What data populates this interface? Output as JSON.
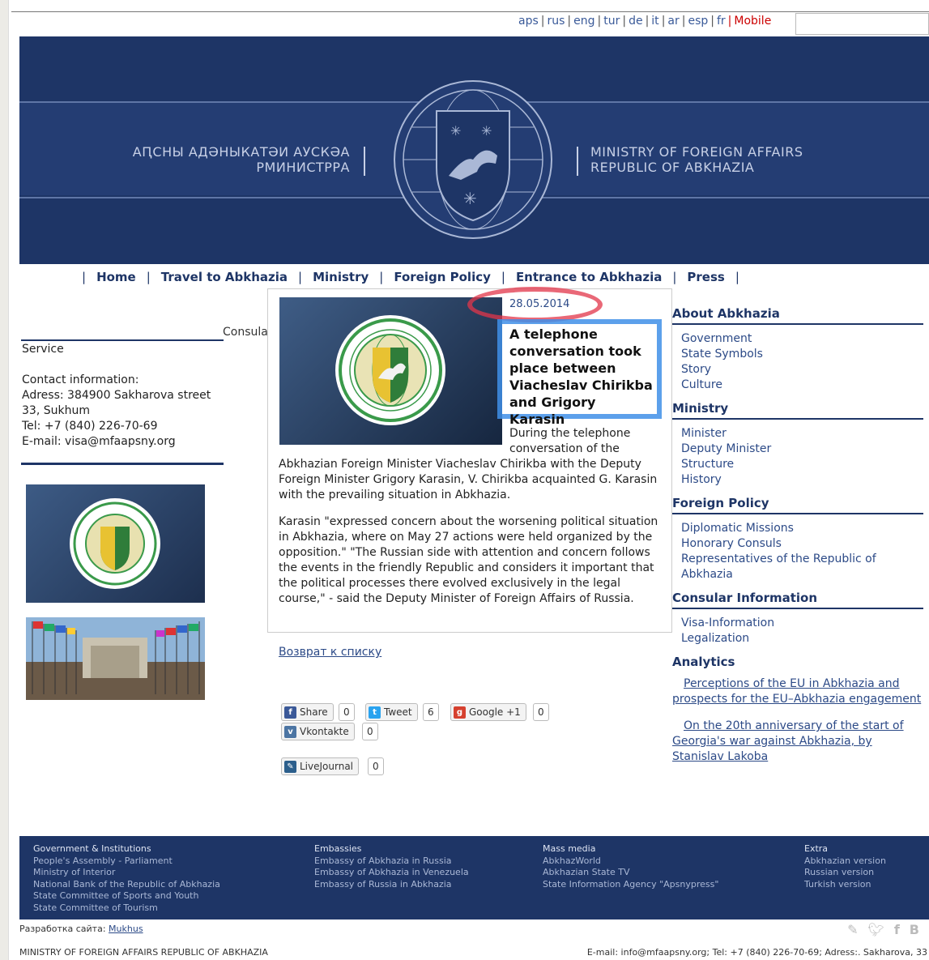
{
  "langbar": {
    "items": [
      "aps",
      "rus",
      "eng",
      "tur",
      "de",
      "it",
      "ar",
      "esp",
      "fr"
    ],
    "mobile": "Mobile"
  },
  "header": {
    "left_line1": "АԤСНЫ АДӘНЫКАТӘИ АУСКӘА",
    "left_line2": "РМИНИСТРРА",
    "right_line1": "MINISTRY OF FOREIGN AFFAIRS",
    "right_line2": "REPUBLIC OF ABKHAZIA"
  },
  "nav": {
    "items": [
      "Home",
      "Travel to Abkhazia",
      "Ministry",
      "Foreign Policy",
      "Entrance to Abkhazia",
      "Press"
    ]
  },
  "left": {
    "consular_truncated": "Consular",
    "service": "Service",
    "contact_title": "Contact information:",
    "address": "Adress: 384900 Sakharova street 33, Sukhum",
    "tel": "Tel: +7 (840) 226-70-69",
    "email": "E-mail: visa@mfaapsny.org"
  },
  "popup": {
    "date": "28.05.2014",
    "title": "A telephone conversation took place between Viacheslav Chirikba and Grigory Karasin",
    "body_start": "During the telephone conversation of the",
    "body_cont": "Abkhazian Foreign Minister Viacheslav Chirikba with the Deputy Foreign Minister Grigory Karasin, V. Chirikba acquainted G. Karasin with the prevailing situation in Abkhazia.",
    "body_p2": "Karasin \"expressed concern about the worsening political situation in Abkhazia, where on May 27 actions were held organized by the opposition.\" \"The Russian side with attention and concern follows the events in the friendly Republic and considers it important that the political processes there evolved exclusively in the legal course,\" - said the Deputy Minister of Foreign Affairs of Russia."
  },
  "back_link": "Возврат к списку",
  "social": {
    "share": {
      "label": "Share",
      "count": "0"
    },
    "tweet": {
      "label": "Tweet",
      "count": "6"
    },
    "google": {
      "label": "Google +1",
      "count": "0"
    },
    "vk": {
      "label": "Vkontakte",
      "count": "0"
    },
    "lj": {
      "label": "LiveJournal",
      "count": "0"
    }
  },
  "right": {
    "about": {
      "heading": "About Abkhazia",
      "items": [
        "Government",
        "State Symbols",
        "Story",
        "Culture"
      ]
    },
    "ministry": {
      "heading": "Ministry",
      "items": [
        "Minister",
        "Deputy Minister",
        "Structure",
        "History"
      ]
    },
    "foreign": {
      "heading": "Foreign Policy",
      "items": [
        "Diplomatic Missions",
        "Honorary Consuls",
        "Representatives of the Republic of Abkhazia"
      ]
    },
    "consular": {
      "heading": "Consular Information",
      "items": [
        "Visa-Information",
        "Legalization"
      ]
    },
    "analytics": {
      "heading": "Analytics",
      "links": [
        "Perceptions of the EU in Abkhazia and prospects for the EU–Abkhazia engagement",
        "On the 20th anniversary of the start of Georgia's war against Abkhazia, by Stanislav Lakoba"
      ]
    }
  },
  "footer": {
    "col1": {
      "heading": "Government & Institutions",
      "items": [
        "People's Assembly - Parliament",
        "Ministry of Interior",
        "National Bank of the Republic of Abkhazia",
        "State Committee of Sports and Youth",
        "State Committee of Tourism"
      ]
    },
    "col2": {
      "heading": "Embassies",
      "items": [
        "Embassy of Abkhazia in Russia",
        "Embassy of Abkhazia in Venezuela",
        "Embassy of Russia in Abkhazia"
      ]
    },
    "col3": {
      "heading": "Mass media",
      "items": [
        "AbkhazWorld",
        "Abkhazian State TV",
        "State Information Agency \"Apsnypress\""
      ]
    },
    "col4": {
      "heading": "Extra",
      "items": [
        "Abkhazian version",
        "Russian version",
        "Turkish version"
      ]
    }
  },
  "dev": {
    "label": "Разработка сайта:",
    "link": "Mukhus"
  },
  "bottom": {
    "left": "MINISTRY OF FOREIGN AFFAIRS REPUBLIC OF ABKHAZIA",
    "right": "E-mail: info@mfaapsny.org; Tel: +7 (840) 226-70-69; Adress:. Sakharova, 33"
  },
  "colors": {
    "navy": "#1e3566",
    "link": "#2c4a87",
    "highlight_red": "#e2354a",
    "highlight_blue": "#3f8fe8"
  }
}
